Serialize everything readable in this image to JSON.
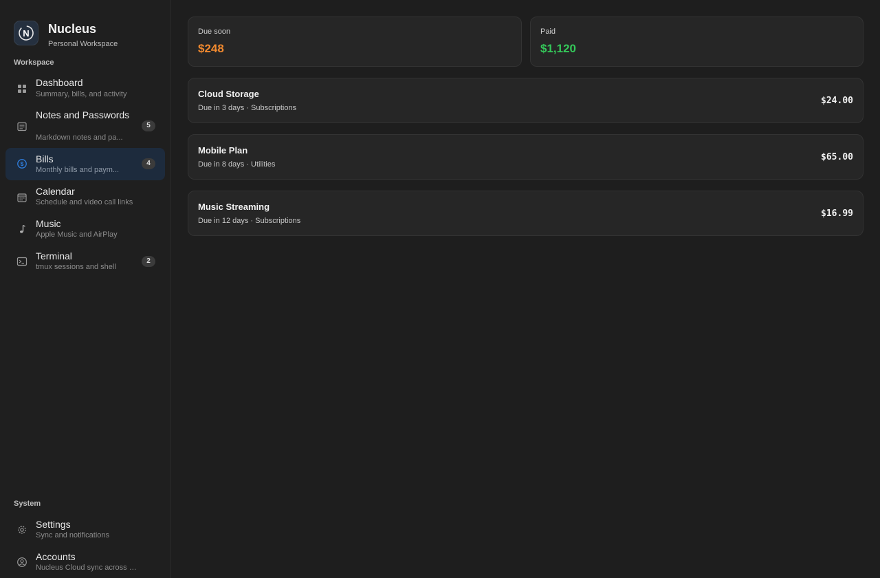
{
  "app": {
    "name": "Nucleus",
    "subtitle": "Personal Workspace",
    "logo_letter": "N"
  },
  "sidebar": {
    "workspace_label": "Workspace",
    "system_label": "System",
    "items": [
      {
        "title": "Dashboard",
        "subtitle": "Summary, bills, and activity",
        "icon": "grid-icon"
      },
      {
        "title": "Notes and Passwords",
        "subtitle": "Markdown notes and pa...",
        "badge": "5",
        "icon": "note-icon"
      },
      {
        "title": "Bills",
        "subtitle": "Monthly bills and paym...",
        "badge": "4",
        "icon": "dollar-circle-icon",
        "active": true
      },
      {
        "title": "Calendar",
        "subtitle": "Schedule and video call links",
        "icon": "calendar-icon"
      },
      {
        "title": "Music",
        "subtitle": "Apple Music and AirPlay",
        "icon": "music-note-icon"
      },
      {
        "title": "Terminal",
        "subtitle": "tmux sessions and shell",
        "badge": "2",
        "icon": "terminal-icon"
      }
    ],
    "system_items": [
      {
        "title": "Settings",
        "subtitle": "Sync and notifications",
        "icon": "gear-icon"
      },
      {
        "title": "Accounts",
        "subtitle": "Nucleus Cloud sync across d...",
        "icon": "account-icon"
      }
    ]
  },
  "summary": {
    "due_soon": {
      "label": "Due soon",
      "value": "$248",
      "color": "#f0892f"
    },
    "paid": {
      "label": "Paid",
      "value": "$1,120",
      "color": "#34c759"
    }
  },
  "bills": [
    {
      "name": "Cloud Storage",
      "meta": "Due in 3 days · Subscriptions",
      "amount": "$24.00"
    },
    {
      "name": "Mobile Plan",
      "meta": "Due in 8 days · Utilities",
      "amount": "$65.00"
    },
    {
      "name": "Music Streaming",
      "meta": "Due in 12 days · Subscriptions",
      "amount": "$16.99"
    }
  ],
  "colors": {
    "accent": "#2f7fe0",
    "active_bg": "#1d2b3d",
    "background": "#1e1e1e"
  }
}
